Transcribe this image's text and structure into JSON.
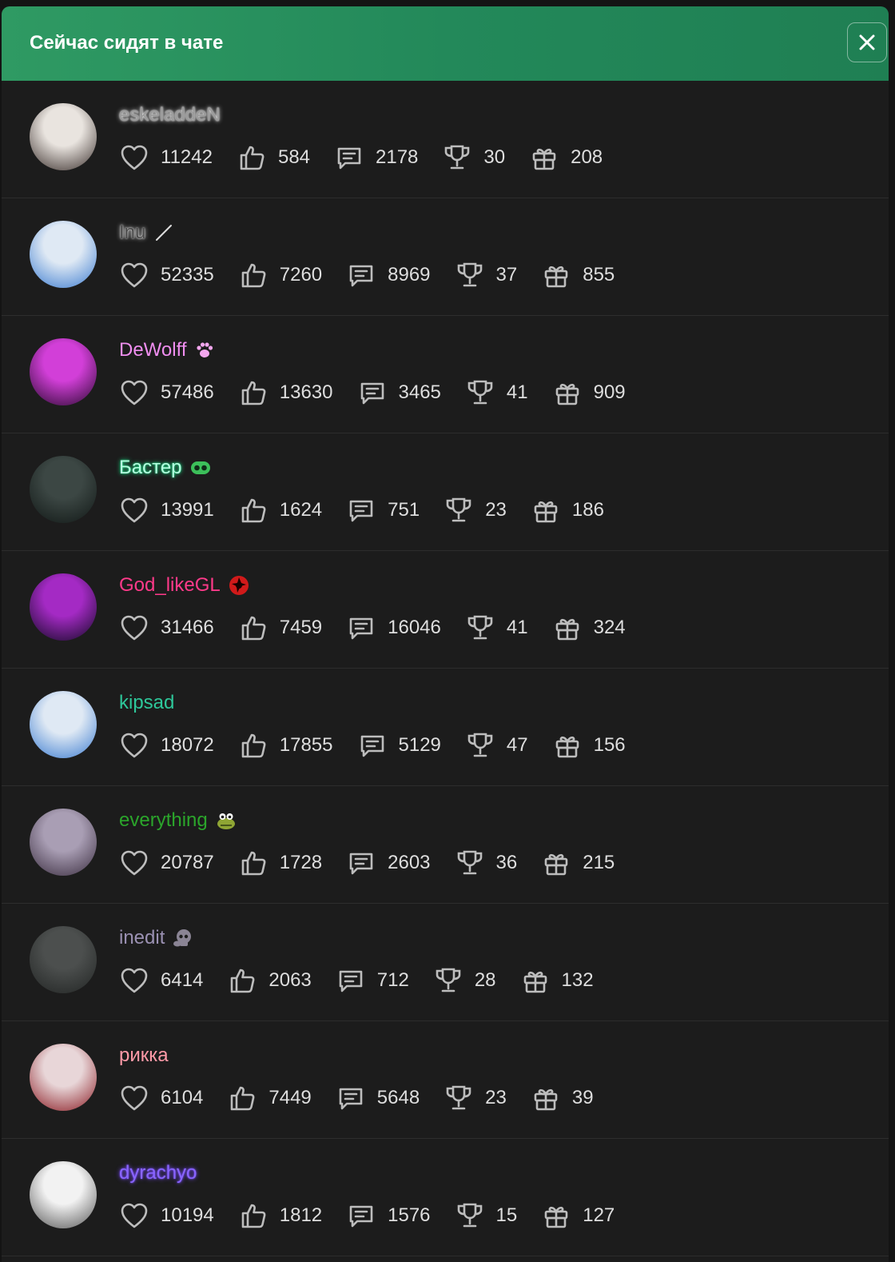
{
  "header": {
    "title": "Сейчас сидят в чате",
    "close_icon": "close-icon"
  },
  "icons": {
    "likes": "heart-icon",
    "thumbs": "thumbs-up-icon",
    "messages": "message-icon",
    "trophies": "trophy-icon",
    "gifts": "gift-icon"
  },
  "users": [
    {
      "nick": "eskeladdeN",
      "color": "#9a9a9a",
      "glow": "#ffffff",
      "badge": "",
      "stats": {
        "likes": "11242",
        "thumbs": "584",
        "messages": "2178",
        "trophies": "30",
        "gifts": "208"
      },
      "avatar": [
        "#e9e4df",
        "#3a2f2c"
      ]
    },
    {
      "nick": "Inu",
      "color": "#4a4a4a",
      "glow": "#ffffff",
      "badge": "slash",
      "stats": {
        "likes": "52335",
        "thumbs": "7260",
        "messages": "8969",
        "trophies": "37",
        "gifts": "855"
      },
      "avatar": [
        "#dfe9f4",
        "#3b7bd0"
      ]
    },
    {
      "nick": "DeWolff",
      "color": "#f08ef0",
      "glow": "",
      "badge": "paw",
      "stats": {
        "likes": "57486",
        "thumbs": "13630",
        "messages": "3465",
        "trophies": "41",
        "gifts": "909"
      },
      "avatar": [
        "#d23fd8",
        "#2a0a30"
      ]
    },
    {
      "nick": "Бастер",
      "color": "#b6ffe0",
      "glow": "#1fe08a",
      "badge": "frog",
      "stats": {
        "likes": "13991",
        "thumbs": "1624",
        "messages": "751",
        "trophies": "23",
        "gifts": "186"
      },
      "avatar": [
        "#3c4744",
        "#111816"
      ]
    },
    {
      "nick": "God_likeGL",
      "color": "#ff3a8a",
      "glow": "",
      "badge": "sharingan",
      "stats": {
        "likes": "31466",
        "thumbs": "7459",
        "messages": "16046",
        "trophies": "41",
        "gifts": "324"
      },
      "avatar": [
        "#a42ac4",
        "#120a24"
      ]
    },
    {
      "nick": "kipsad",
      "color": "#2ec79a",
      "glow": "",
      "badge": "",
      "stats": {
        "likes": "18072",
        "thumbs": "17855",
        "messages": "5129",
        "trophies": "47",
        "gifts": "156"
      },
      "avatar": [
        "#dfe9f4",
        "#3b7bd0"
      ]
    },
    {
      "nick": "everything",
      "color": "#2ba52b",
      "glow": "",
      "badge": "croc",
      "stats": {
        "likes": "20787",
        "thumbs": "1728",
        "messages": "2603",
        "trophies": "36",
        "gifts": "215"
      },
      "avatar": [
        "#a99eb4",
        "#3a2d3f"
      ]
    },
    {
      "nick": "inedit",
      "color": "#9b91b3",
      "glow": "",
      "badge": "skull",
      "stats": {
        "likes": "6414",
        "thumbs": "2063",
        "messages": "712",
        "trophies": "28",
        "gifts": "132"
      },
      "avatar": [
        "#4c4f4e",
        "#222524"
      ]
    },
    {
      "nick": "рикка",
      "color": "#ff9aa8",
      "glow": "",
      "badge": "",
      "stats": {
        "likes": "6104",
        "thumbs": "7449",
        "messages": "5648",
        "trophies": "23",
        "gifts": "39"
      },
      "avatar": [
        "#e8d6d8",
        "#8a1a22"
      ]
    },
    {
      "nick": "dyrachyo",
      "color": "#8a66ff",
      "glow": "#7a4dff",
      "badge": "",
      "stats": {
        "likes": "10194",
        "thumbs": "1812",
        "messages": "1576",
        "trophies": "15",
        "gifts": "127"
      },
      "avatar": [
        "#f2f2f2",
        "#555555"
      ]
    }
  ]
}
